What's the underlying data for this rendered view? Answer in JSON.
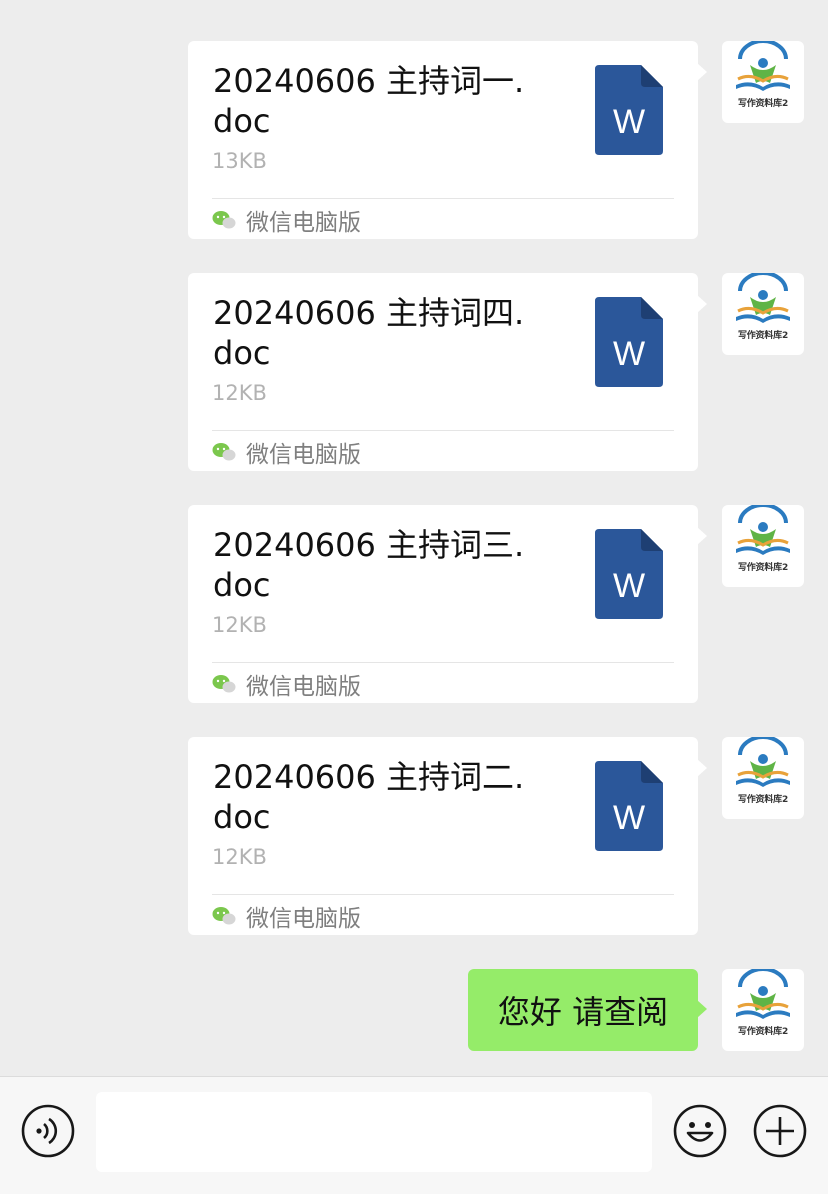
{
  "messages": [
    {
      "type": "file",
      "name": "20240606 主持词一.doc",
      "size": "13KB",
      "source": "微信电脑版",
      "file_icon_letter": "W"
    },
    {
      "type": "file",
      "name": "20240606 主持词四.doc",
      "size": "12KB",
      "source": "微信电脑版",
      "file_icon_letter": "W"
    },
    {
      "type": "file",
      "name": "20240606 主持词三.doc",
      "size": "12KB",
      "source": "微信电脑版",
      "file_icon_letter": "W"
    },
    {
      "type": "file",
      "name": "20240606 主持词二.doc",
      "size": "12KB",
      "source": "微信电脑版",
      "file_icon_letter": "W"
    },
    {
      "type": "text",
      "text": "您好 请查阅"
    }
  ],
  "avatar": {
    "caption": "写作资料库2",
    "icon": "book-person-logo"
  },
  "colors": {
    "background": "#ededed",
    "bubble_sent": "#95ec69",
    "card": "#ffffff",
    "word_blue": "#2b579a",
    "source_green": "#7bc74d"
  },
  "input_bar": {
    "placeholder": "",
    "icons": [
      "voice-icon",
      "emoji-icon",
      "plus-icon"
    ]
  }
}
